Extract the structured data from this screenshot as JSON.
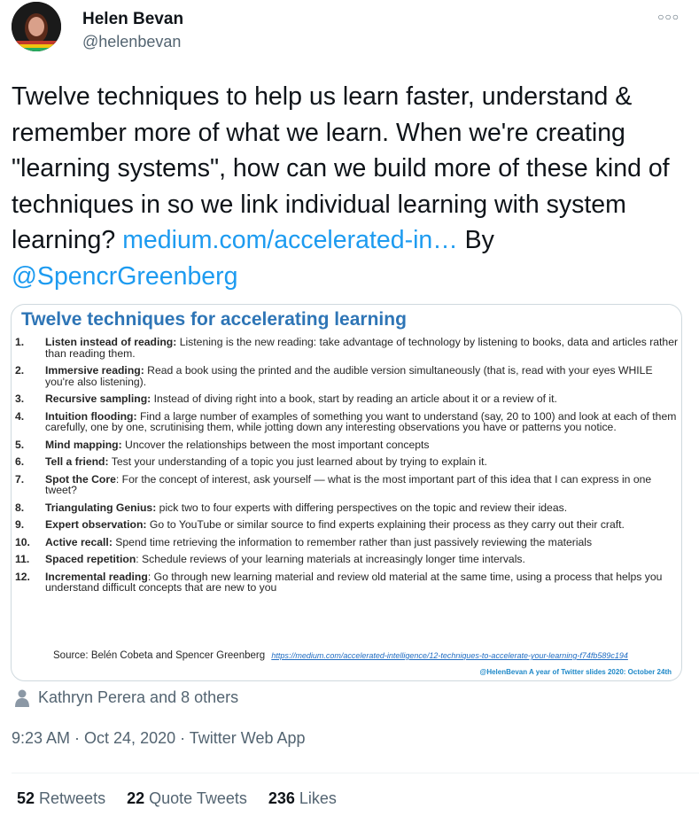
{
  "author": {
    "name": "Helen Bevan",
    "handle": "@helenbevan"
  },
  "tweet": {
    "text_main": "Twelve techniques to help us learn faster, understand & remember more of what we learn. When we're creating \"learning systems\", how can we build more of these kind of techniques in so we link individual learning with system learning? ",
    "link_text": "medium.com/accelerated-in…",
    "by_text": " By ",
    "mention": "@SpencrGreenberg"
  },
  "slide": {
    "title": "Twelve techniques for accelerating learning",
    "items": [
      {
        "num": "1.",
        "term": "Listen instead of reading:",
        "text": " Listening is the new reading: take advantage of technology by listening to books, data and articles rather than reading them."
      },
      {
        "num": "2.",
        "term": "Immersive reading:",
        "text": " Read a book using the printed and the audible version simultaneously (that is, read with your eyes WHILE you're also listening)."
      },
      {
        "num": "3.",
        "term": "Recursive sampling:",
        "text": " Instead of diving right into a book, start by reading an article about it or a review of it."
      },
      {
        "num": "4.",
        "term": "Intuition flooding:",
        "text": " Find a large number of examples of something you want to understand (say, 20 to 100) and look at each of them carefully, one by one, scrutinising them, while jotting down any interesting observations you have or patterns you notice."
      },
      {
        "num": "5.",
        "term": "Mind mapping:",
        "text": " Uncover the relationships between the most important concepts"
      },
      {
        "num": "6.",
        "term": "Tell a friend:",
        "text": " Test your understanding of a topic you just learned about by trying to explain it."
      },
      {
        "num": "7.",
        "term": "Spot the Core",
        "text": ": For the concept of interest, ask yourself — what is the most important part of this idea that I can express in one tweet?"
      },
      {
        "num": "8.",
        "term": "Triangulating Genius:",
        "text": " pick two to four experts with differing perspectives on the topic and review their ideas."
      },
      {
        "num": "9.",
        "term": "Expert observation:",
        "text": " Go to YouTube or similar source to find experts explaining their process as they carry out their craft."
      },
      {
        "num": "10.",
        "term": "Active recall:",
        "text": " Spend time retrieving the information to remember rather than just passively reviewing the materials"
      },
      {
        "num": "11.",
        "term": "Spaced repetition",
        "text": ": Schedule reviews of your learning materials at increasingly longer time intervals."
      },
      {
        "num": "12.",
        "term": "Incremental reading",
        "text": ": Go through new learning material and review old material at the same time, using a process that helps you understand difficult concepts that are new to you"
      }
    ],
    "source_label": "Source: Belén Cobeta and Spencer Greenberg",
    "source_url": "https://medium.com/accelerated-intelligence/12-techniques-to-accelerate-your-learning-f74fb589c194",
    "credit": "@HelenBevan A year of Twitter slides 2020: October 24th"
  },
  "likers": "Kathryn Perera and 8 others",
  "meta": "9:23 AM · Oct 24, 2020 · Twitter Web App",
  "stats": {
    "retweets_count": "52",
    "retweets_label": "Retweets",
    "quotes_count": "22",
    "quotes_label": "Quote Tweets",
    "likes_count": "236",
    "likes_label": "Likes"
  }
}
